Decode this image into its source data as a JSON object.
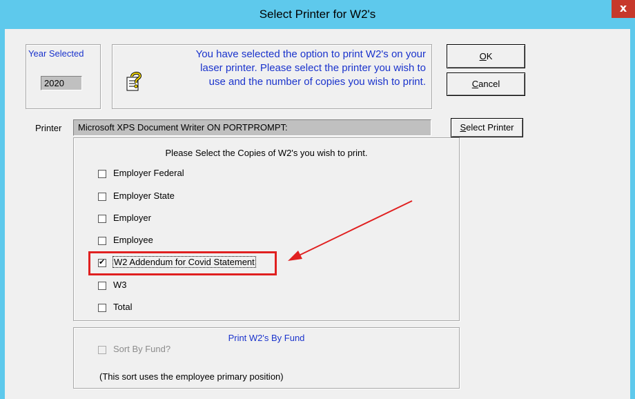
{
  "window": {
    "title": "Select Printer for W2's",
    "close_label": "x"
  },
  "year": {
    "label": "Year Selected",
    "value": "2020"
  },
  "info": {
    "line1": "You have selected the option to print W2's on your",
    "line2": "laser printer. Please select the printer you wish to",
    "line3": "use and the number of copies you wish to print."
  },
  "buttons": {
    "ok_u": "O",
    "ok_rest": "K",
    "cancel_u": "C",
    "cancel_rest": "ancel",
    "select_u": "S",
    "select_rest": "elect Printer"
  },
  "printer": {
    "label": "Printer",
    "value": "Microsoft XPS Document Writer ON PORTPROMPT:"
  },
  "copies": {
    "heading": "Please Select the Copies of W2's you wish to print.",
    "items": [
      {
        "label": "Employer Federal",
        "checked": false
      },
      {
        "label": "Employer State",
        "checked": false
      },
      {
        "label": "Employer",
        "checked": false
      },
      {
        "label": "Employee",
        "checked": false
      },
      {
        "label": "W2 Addendum for Covid Statement",
        "checked": true
      },
      {
        "label": "W3",
        "checked": false
      },
      {
        "label": "Total",
        "checked": false
      }
    ]
  },
  "fund": {
    "heading": "Print W2's By Fund",
    "sort_label": "Sort By Fund?",
    "note": "(This sort uses the employee primary position)"
  },
  "colors": {
    "titlebar": "#5ec9ec",
    "accent_text": "#1a33cc",
    "highlight": "#e02020",
    "close": "#c7382b"
  }
}
